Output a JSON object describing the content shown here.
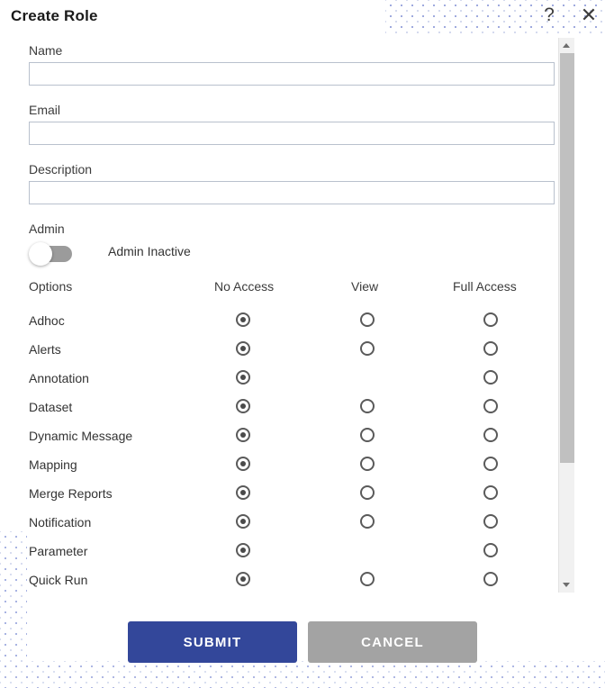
{
  "header": {
    "title": "Create Role",
    "help_icon": "question-mark-icon",
    "close_icon": "close-icon"
  },
  "form": {
    "fields": [
      {
        "label": "Name",
        "value": "",
        "placeholder": ""
      },
      {
        "label": "Email",
        "value": "",
        "placeholder": ""
      },
      {
        "label": "Description",
        "value": "",
        "placeholder": ""
      }
    ],
    "admin": {
      "label": "Admin",
      "toggle_state": "off",
      "toggle_status_text": "Admin Inactive"
    }
  },
  "permissions": {
    "columns": [
      "Options",
      "No Access",
      "View",
      "Full Access"
    ],
    "rows": [
      {
        "name": "Adhoc",
        "selected": "No Access",
        "has_view": true
      },
      {
        "name": "Alerts",
        "selected": "No Access",
        "has_view": true
      },
      {
        "name": "Annotation",
        "selected": "No Access",
        "has_view": false
      },
      {
        "name": "Dataset",
        "selected": "No Access",
        "has_view": true
      },
      {
        "name": "Dynamic Message",
        "selected": "No Access",
        "has_view": true
      },
      {
        "name": "Mapping",
        "selected": "No Access",
        "has_view": true
      },
      {
        "name": "Merge Reports",
        "selected": "No Access",
        "has_view": true
      },
      {
        "name": "Notification",
        "selected": "No Access",
        "has_view": true
      },
      {
        "name": "Parameter",
        "selected": "No Access",
        "has_view": false
      },
      {
        "name": "Quick Run",
        "selected": "No Access",
        "has_view": true
      }
    ]
  },
  "footer": {
    "submit_label": "SUBMIT",
    "cancel_label": "CANCEL"
  },
  "scrollbar": {
    "up_arrow_icon": "triangle-up-icon",
    "down_arrow_icon": "triangle-down-icon"
  },
  "colors": {
    "submit": "#33479a",
    "cancel": "#a3a3a3",
    "toggle_track": "#9b9b9b",
    "input_border": "#b9c1cd",
    "dots": "#9aa6dd"
  }
}
